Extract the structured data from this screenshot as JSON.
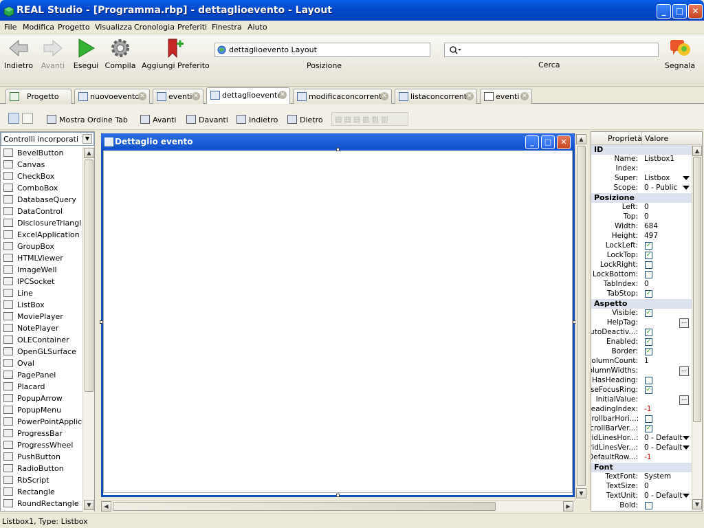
{
  "window": {
    "title": "REAL Studio - [Programma.rbp] - dettaglioevento - Layout"
  },
  "menu": [
    "File",
    "Modifica",
    "Progetto",
    "Visualizza",
    "Cronologia",
    "Preferiti",
    "Finestra",
    "Aiuto"
  ],
  "toolbar": {
    "back": "Indietro",
    "forward": "Avanti",
    "run": "Esegui",
    "compile": "Compila",
    "bookmark": "Aggiungi Preferito",
    "location_value": "dettaglioevento Layout",
    "location_label": "Posizione",
    "search_label": "Cerca",
    "report": "Segnala"
  },
  "tabs": [
    {
      "label": "Progetto"
    },
    {
      "label": "nuovoevento"
    },
    {
      "label": "eventi"
    },
    {
      "label": "dettaglioevento"
    },
    {
      "label": "modificaconcorrente"
    },
    {
      "label": "listaconcorrenti"
    },
    {
      "label": "eventi"
    }
  ],
  "layout_toolbar": {
    "tab_order": "Mostra Ordine Tab",
    "forward": "Avanti",
    "front": "Davanti",
    "backward": "Indietro",
    "back": "Dietro"
  },
  "controls": {
    "selected": "Controlli incorporati",
    "items": [
      "BevelButton",
      "Canvas",
      "CheckBox",
      "ComboBox",
      "DatabaseQuery",
      "DataControl",
      "DisclosureTriangle",
      "ExcelApplication",
      "GroupBox",
      "HTMLViewer",
      "ImageWell",
      "IPCSocket",
      "Line",
      "ListBox",
      "MoviePlayer",
      "NotePlayer",
      "OLEContainer",
      "OpenGLSurface",
      "Oval",
      "PagePanel",
      "Placard",
      "PopupArrow",
      "PopupMenu",
      "PowerPointApplic...",
      "ProgressBar",
      "ProgressWheel",
      "PushButton",
      "RadioButton",
      "RbScript",
      "Rectangle",
      "RoundRectangle"
    ]
  },
  "design_window": {
    "title": "Dettaglio evento"
  },
  "properties": {
    "col_name": "Proprietà",
    "col_value": "Valore",
    "groups": {
      "id": "ID",
      "position": "Posizione",
      "appearance": "Aspetto",
      "font": "Font"
    },
    "rows": [
      {
        "name": "Name:",
        "value": "Listbox1"
      },
      {
        "name": "Index:",
        "value": ""
      },
      {
        "name": "Super:",
        "value": "Listbox"
      },
      {
        "name": "Scope:",
        "value": "0 - Public"
      },
      {
        "name": "Left:",
        "value": "0"
      },
      {
        "name": "Top:",
        "value": "0"
      },
      {
        "name": "Width:",
        "value": "684"
      },
      {
        "name": "Height:",
        "value": "497"
      },
      {
        "name": "LockLeft:",
        "value": "✓"
      },
      {
        "name": "LockTop:",
        "value": "✓"
      },
      {
        "name": "LockRight:",
        "value": ""
      },
      {
        "name": "LockBottom:",
        "value": ""
      },
      {
        "name": "TabIndex:",
        "value": "0"
      },
      {
        "name": "TabStop:",
        "value": "✓"
      },
      {
        "name": "Visible:",
        "value": "✓"
      },
      {
        "name": "HelpTag:",
        "value": "..."
      },
      {
        "name": "AutoDeactiv...:",
        "value": "✓"
      },
      {
        "name": "Enabled:",
        "value": "✓"
      },
      {
        "name": "Border:",
        "value": "✓"
      },
      {
        "name": "ColumnCount:",
        "value": "1"
      },
      {
        "name": "ColumnWidths:",
        "value": "..."
      },
      {
        "name": "HasHeading:",
        "value": ""
      },
      {
        "name": "UseFocusRing:",
        "value": "✓"
      },
      {
        "name": "InitialValue:",
        "value": "..."
      },
      {
        "name": "HeadingIndex:",
        "value": "-1"
      },
      {
        "name": "ScrollbarHori...:",
        "value": ""
      },
      {
        "name": "ScrollBarVer...:",
        "value": "✓"
      },
      {
        "name": "GridLinesHor...:",
        "value": "0 - Default"
      },
      {
        "name": "GridLinesVer...:",
        "value": "0 - Default"
      },
      {
        "name": "DefaultRow...:",
        "value": "-1"
      },
      {
        "name": "TextFont:",
        "value": "System"
      },
      {
        "name": "TextSize:",
        "value": "0"
      },
      {
        "name": "TextUnit:",
        "value": "0 - Default"
      },
      {
        "name": "Bold:",
        "value": ""
      }
    ]
  },
  "status": "Listbox1, Type: Listbox"
}
